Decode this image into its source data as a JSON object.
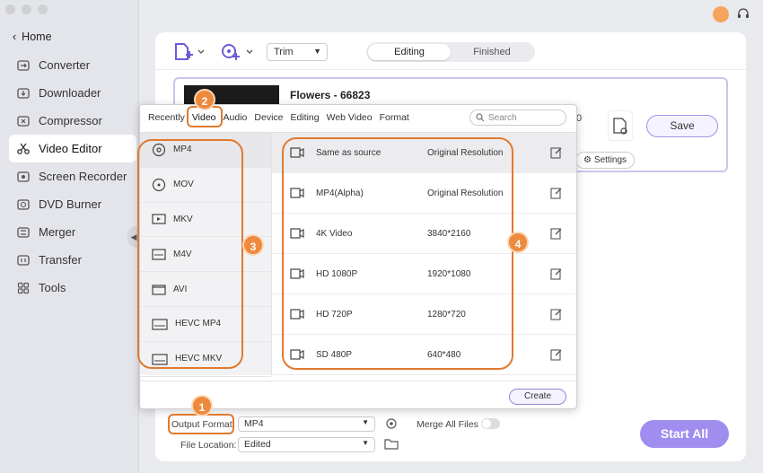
{
  "sidebar": {
    "home_label": "Home",
    "items": [
      {
        "label": "Converter",
        "icon": "converter-icon"
      },
      {
        "label": "Downloader",
        "icon": "downloader-icon"
      },
      {
        "label": "Compressor",
        "icon": "compressor-icon"
      },
      {
        "label": "Video Editor",
        "icon": "scissors-icon",
        "active": true
      },
      {
        "label": "Screen Recorder",
        "icon": "screen-recorder-icon"
      },
      {
        "label": "DVD Burner",
        "icon": "dvd-icon"
      },
      {
        "label": "Merger",
        "icon": "merger-icon"
      },
      {
        "label": "Transfer",
        "icon": "transfer-icon"
      },
      {
        "label": "Tools",
        "icon": "tools-icon"
      }
    ]
  },
  "toolbar": {
    "trim_label": "Trim",
    "segment": {
      "editing": "Editing",
      "finished": "Finished"
    }
  },
  "video": {
    "title": "Flowers - 66823",
    "size_fragment": "0",
    "save_label": "Save",
    "settings_label": "Settings"
  },
  "popup": {
    "tabs": [
      "Recently",
      "Video",
      "Audio",
      "Device",
      "Editing",
      "Web Video",
      "Format"
    ],
    "active_tab": "Video",
    "search_placeholder": "Search",
    "formats": [
      "MP4",
      "MOV",
      "MKV",
      "M4V",
      "AVI",
      "HEVC MP4",
      "HEVC MKV"
    ],
    "presets": [
      {
        "name": "Same as source",
        "resolution": "Original Resolution"
      },
      {
        "name": "MP4(Alpha)",
        "resolution": "Original Resolution"
      },
      {
        "name": "4K Video",
        "resolution": "3840*2160"
      },
      {
        "name": "HD 1080P",
        "resolution": "1920*1080"
      },
      {
        "name": "HD 720P",
        "resolution": "1280*720"
      },
      {
        "name": "SD 480P",
        "resolution": "640*480"
      }
    ],
    "create_label": "Create"
  },
  "bottom": {
    "output_format_label": "Output Format:",
    "output_format_value": "MP4",
    "merge_label": "Merge All Files",
    "file_location_label": "File Location:",
    "file_location_value": "Edited",
    "start_all_label": "Start All"
  },
  "annotations": [
    "1",
    "2",
    "3",
    "4"
  ],
  "colors": {
    "accent": "#a08df0",
    "annotation": "#ee8a3e",
    "highlight": "#e07a2e"
  }
}
